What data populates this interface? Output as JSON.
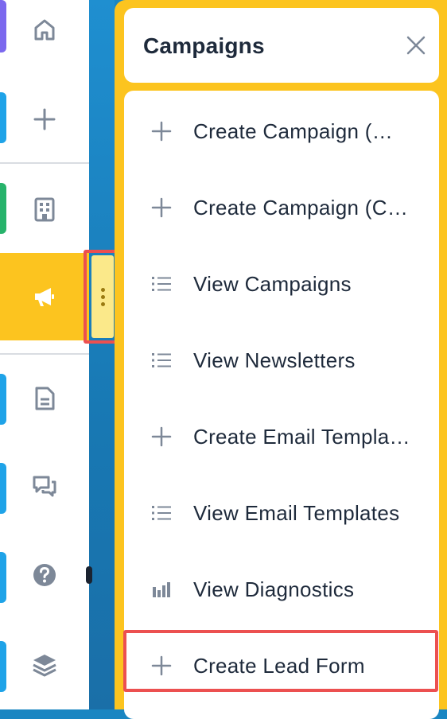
{
  "nav": {
    "items": [
      {
        "name": "home",
        "icon": "home-icon",
        "accent": "#7b68ee"
      },
      {
        "name": "create",
        "icon": "plus-icon",
        "accent": "#1fa3e8"
      },
      {
        "name": "accounts",
        "icon": "building-icon",
        "accent": "#27b36b"
      },
      {
        "name": "campaigns",
        "icon": "megaphone-icon",
        "accent": "#fcc41f",
        "active": true
      },
      {
        "name": "documents",
        "icon": "document-icon",
        "accent": "#1fa3e8"
      },
      {
        "name": "messages",
        "icon": "chat-icon",
        "accent": "#1fa3e8"
      },
      {
        "name": "help",
        "icon": "question-icon",
        "accent": "#1fa3e8"
      },
      {
        "name": "layers",
        "icon": "layers-icon",
        "accent": "#1fa3e8"
      }
    ]
  },
  "panel": {
    "title": "Campaigns",
    "close_icon": "close-icon",
    "items": [
      {
        "label": "Create Campaign (…",
        "icon": "plus-icon"
      },
      {
        "label": "Create Campaign (C…",
        "icon": "plus-icon"
      },
      {
        "label": "View Campaigns",
        "icon": "list-icon"
      },
      {
        "label": "View Newsletters",
        "icon": "list-icon"
      },
      {
        "label": "Create Email Templa…",
        "icon": "plus-icon"
      },
      {
        "label": "View Email Templates",
        "icon": "list-icon"
      },
      {
        "label": "View Diagnostics",
        "icon": "bar-chart-icon"
      },
      {
        "label": "Create Lead Form",
        "icon": "plus-icon",
        "highlighted": true
      }
    ]
  },
  "colors": {
    "accent_yellow": "#fcc41f",
    "highlight_red": "#ec5050",
    "text_dark": "#1e2a3b",
    "icon_gray": "#7d8898"
  }
}
